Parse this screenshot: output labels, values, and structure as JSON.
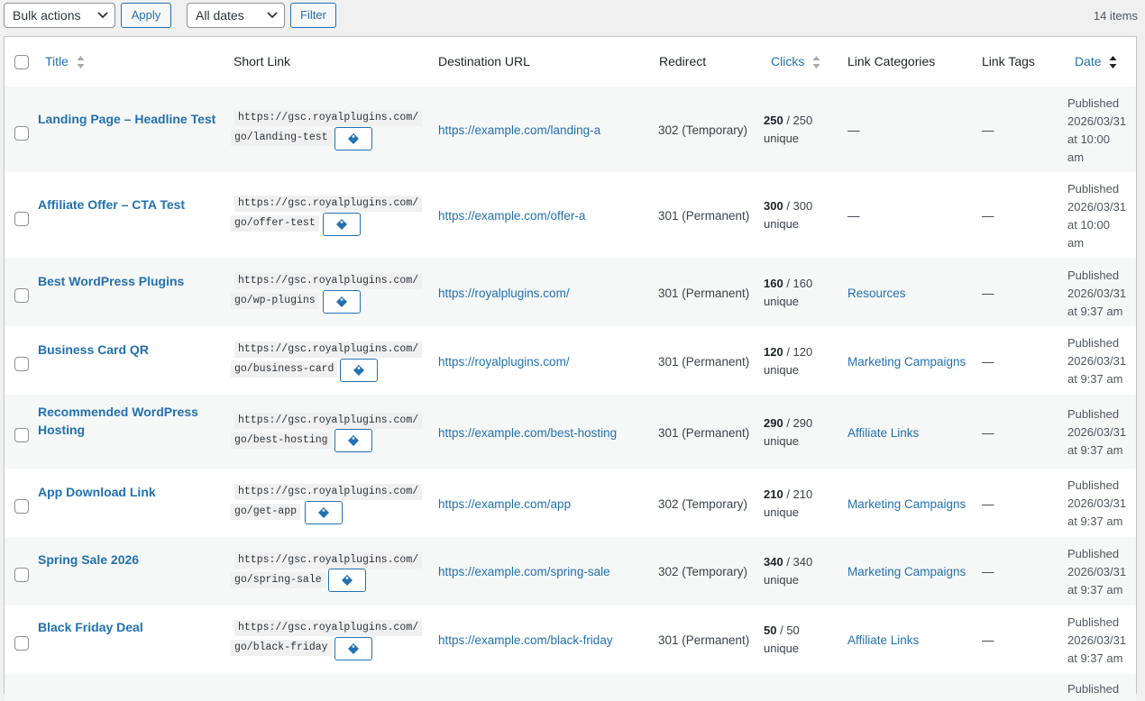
{
  "toolbar": {
    "bulk_actions_label": "Bulk actions",
    "apply_label": "Apply",
    "dates_label": "All dates",
    "filter_label": "Filter",
    "items_count": "14 items"
  },
  "columns": {
    "title": "Title",
    "short_link": "Short Link",
    "destination": "Destination URL",
    "redirect": "Redirect",
    "clicks": "Clicks",
    "categories": "Link Categories",
    "tags": "Link Tags",
    "date": "Date"
  },
  "rows": [
    {
      "title": "Landing Page – Headline Test",
      "short_1": "https://gsc.royalplugins.com/",
      "short_2": "go/landing-test",
      "dest": "https://example.com/landing-a",
      "redirect": "302 (Temporary)",
      "clicks": "250",
      "clicks_unique": "250",
      "unique_label": "unique",
      "category": "—",
      "tags": "—",
      "date_1": "Published",
      "date_2": "2026/03/31",
      "date_3": "at 10:00",
      "date_4": "am"
    },
    {
      "title": "Affiliate Offer – CTA Test",
      "short_1": "https://gsc.royalplugins.com/",
      "short_2": "go/offer-test",
      "dest": "https://example.com/offer-a",
      "redirect": "301 (Permanent)",
      "clicks": "300",
      "clicks_unique": "300",
      "unique_label": "unique",
      "category": "—",
      "tags": "—",
      "date_1": "Published",
      "date_2": "2026/03/31",
      "date_3": "at 10:00",
      "date_4": "am"
    },
    {
      "title": "Best WordPress Plugins",
      "short_1": "https://gsc.royalplugins.com/",
      "short_2": "go/wp-plugins",
      "dest": "https://royalplugins.com/",
      "redirect": "301 (Permanent)",
      "clicks": "160",
      "clicks_unique": "160",
      "unique_label": "unique",
      "category": "Resources",
      "tags": "—",
      "date_1": "Published",
      "date_2": "2026/03/31",
      "date_3": "at 9:37 am",
      "date_4": ""
    },
    {
      "title": "Business Card QR",
      "short_1": "https://gsc.royalplugins.com/",
      "short_2": "go/business-card",
      "dest": "https://royalplugins.com/",
      "redirect": "301 (Permanent)",
      "clicks": "120",
      "clicks_unique": "120",
      "unique_label": "unique",
      "category": "Marketing Campaigns",
      "tags": "—",
      "date_1": "Published",
      "date_2": "2026/03/31",
      "date_3": "at 9:37 am",
      "date_4": ""
    },
    {
      "title_1": "Recommended WordPress",
      "title_2": "Hosting",
      "short_1": "https://gsc.royalplugins.com/",
      "short_2": "go/best-hosting",
      "dest": "https://example.com/best-hosting",
      "redirect": "301 (Permanent)",
      "clicks": "290",
      "clicks_unique": "290",
      "unique_label": "unique",
      "category": "Affiliate Links",
      "tags": "—",
      "date_1": "Published",
      "date_2": "2026/03/31",
      "date_3": "at 9:37 am",
      "date_4": ""
    },
    {
      "title": "App Download Link",
      "short_1": "https://gsc.royalplugins.com/",
      "short_2": "go/get-app",
      "dest": "https://example.com/app",
      "redirect": "302 (Temporary)",
      "clicks": "210",
      "clicks_unique": "210",
      "unique_label": "unique",
      "category": "Marketing Campaigns",
      "tags": "—",
      "date_1": "Published",
      "date_2": "2026/03/31",
      "date_3": "at 9:37 am",
      "date_4": ""
    },
    {
      "title": "Spring Sale 2026",
      "short_1": "https://gsc.royalplugins.com/",
      "short_2": "go/spring-sale",
      "dest": "https://example.com/spring-sale",
      "redirect": "302 (Temporary)",
      "clicks": "340",
      "clicks_unique": "340",
      "unique_label": "unique",
      "category": "Marketing Campaigns",
      "tags": "—",
      "date_1": "Published",
      "date_2": "2026/03/31",
      "date_3": "at 9:37 am",
      "date_4": ""
    },
    {
      "title": "Black Friday Deal",
      "short_1": "https://gsc.royalplugins.com/",
      "short_2": "go/black-friday",
      "dest": "https://example.com/black-friday",
      "redirect": "301 (Permanent)",
      "clicks": "50",
      "clicks_unique": "50",
      "unique_label": "unique",
      "category": "Affiliate Links",
      "tags": "—",
      "date_1": "Published",
      "date_2": "2026/03/31",
      "date_3": "at 9:37 am",
      "date_4": ""
    }
  ],
  "partial_row": {
    "date_1": "Published"
  },
  "colors": {
    "link": "#2271b1",
    "alt_row": "#f6f7f7",
    "border": "#c3c4c7"
  }
}
